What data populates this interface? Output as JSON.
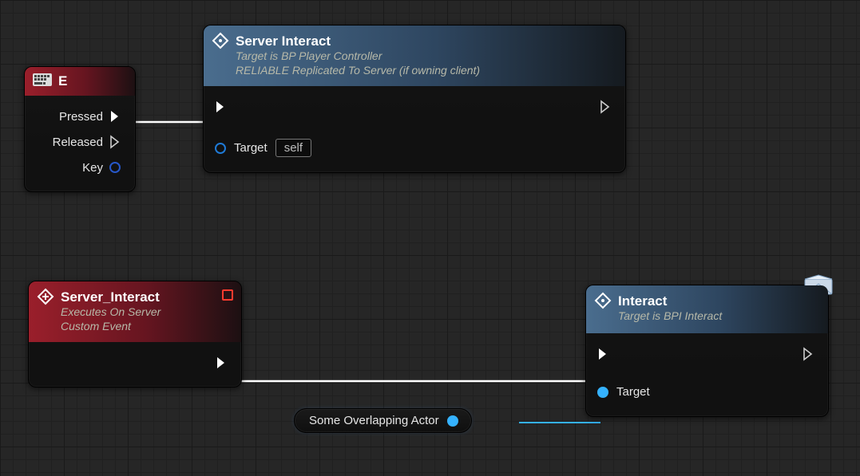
{
  "nodes": {
    "input_e": {
      "title": "E",
      "pins": {
        "pressed": "Pressed",
        "released": "Released",
        "key": "Key"
      }
    },
    "server_interact_call": {
      "title": "Server Interact",
      "subtitle1": "Target is BP Player Controller",
      "subtitle2": "RELIABLE Replicated To Server (if owning client)",
      "target_label": "Target",
      "target_value": "self"
    },
    "server_interact_event": {
      "title": "Server_Interact",
      "subtitle1": "Executes On Server",
      "subtitle2": "Custom Event"
    },
    "interact": {
      "title": "Interact",
      "subtitle": "Target is BPI Interact",
      "target_label": "Target"
    },
    "var_actor": {
      "label": "Some Overlapping Actor"
    }
  }
}
